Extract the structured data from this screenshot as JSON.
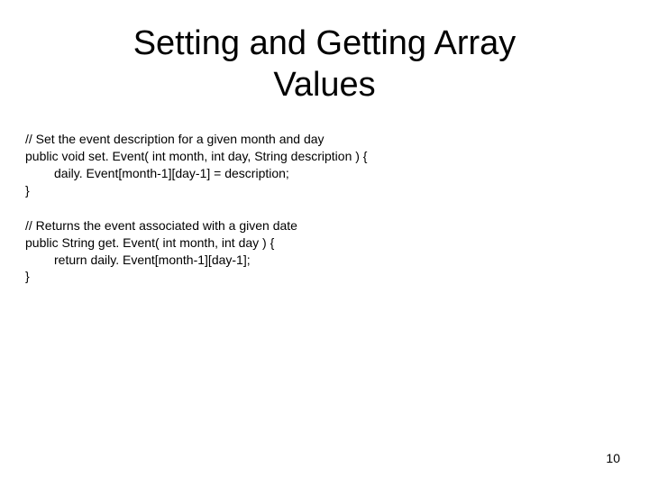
{
  "title": "Setting and Getting Array Values",
  "block1": {
    "l1": "// Set the event description for a given month and day",
    "l2": "public void set. Event( int month, int day, String description ) {",
    "l3": "daily. Event[month-1][day-1] = description;",
    "l4": "}"
  },
  "block2": {
    "l1": "// Returns the event associated with a given date",
    "l2": "public String get. Event( int month, int day ) {",
    "l3": "return daily. Event[month-1][day-1];",
    "l4": "}"
  },
  "page_number": "10"
}
